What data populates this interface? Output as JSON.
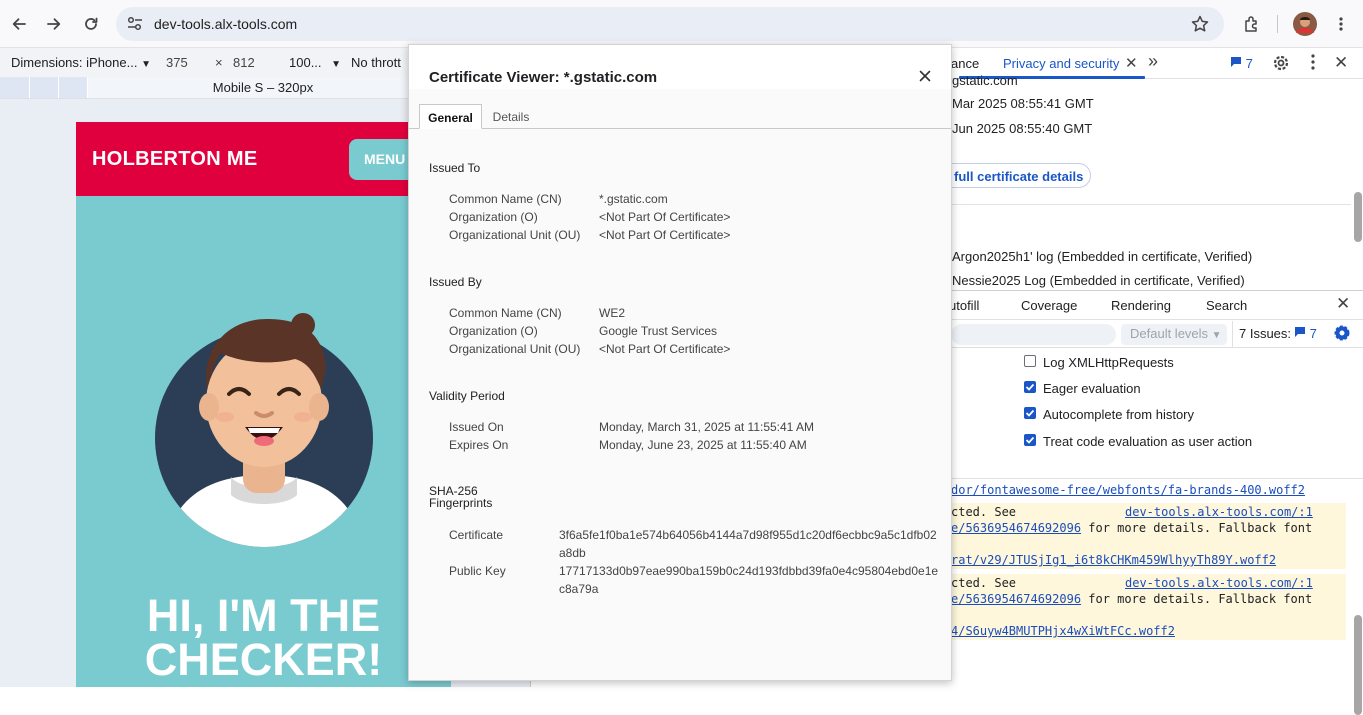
{
  "browser": {
    "url": "dev-tools.alx-tools.com"
  },
  "device_toolbar": {
    "dimensions_label": "Dimensions: iPhone...",
    "width": "375",
    "times": "×",
    "height": "812",
    "zoom": "100...",
    "throttle": "No thrott",
    "ruler_label": "Mobile S – 320px"
  },
  "site": {
    "brand": "HOLBERTON ME",
    "menu_label": "MENU",
    "hero_line1": "HI, I'M THE",
    "hero_line2": "CHECKER!",
    "colors": {
      "header": "#e1003e",
      "background": "#79cbd0"
    }
  },
  "devtools": {
    "tabs": [
      {
        "label": "ance"
      },
      {
        "label": "Privacy and security"
      }
    ],
    "more_tabs": "»",
    "issues_count": "7",
    "security_panel": {
      "line_subject": "gstatic.com",
      "line_valid_from": "Mar 2025 08:55:41 GMT",
      "line_valid_to": "Jun 2025 08:55:40 GMT",
      "cert_button": "full certificate details",
      "log1": "Argon2025h1' log (Embedded in certificate, Verified)",
      "log2": "Nessie2025 Log (Embedded in certificate, Verified)"
    },
    "drawer_tabs": [
      "utofill",
      "Coverage",
      "Rendering",
      "Search"
    ],
    "console_bar": {
      "levels": "Default levels",
      "issues_text": "7 Issues:",
      "issues_count": "7"
    },
    "settings": [
      {
        "label": "Log XMLHttpRequests",
        "checked": false
      },
      {
        "label": "Eager evaluation",
        "checked": true
      },
      {
        "label": "Autocomplete from history",
        "checked": true
      },
      {
        "label": "Treat code evaluation as user action",
        "checked": true
      }
    ],
    "console_lines": {
      "l1": "dor/fontawesome-free/webfonts/fa-brands-400.woff2",
      "w1a": "cted. See",
      "w1link": "dev-tools.alx-tools.com/:1",
      "w1b": "e/5636954674692096",
      "w1c": " for more details. Fallback font",
      "w1d": "rat/v29/JTUSjIg1_i6t8kCHKm459WlhyyTh89Y.woff2",
      "w2a": "cted. See",
      "w2link": "dev-tools.alx-tools.com/:1",
      "w2b": "e/5636954674692096",
      "w2c": " for more details. Fallback font",
      "w2d": "4/S6uyw4BMUTPHjx4wXiWtFCc.woff2"
    }
  },
  "certificate_viewer": {
    "title": "Certificate Viewer: *.gstatic.com",
    "tabs": {
      "general": "General",
      "details": "Details"
    },
    "issued_to": {
      "heading": "Issued To",
      "cn_label": "Common Name (CN)",
      "cn": "*.gstatic.com",
      "o_label": "Organization (O)",
      "o": "<Not Part Of Certificate>",
      "ou_label": "Organizational Unit (OU)",
      "ou": "<Not Part Of Certificate>"
    },
    "issued_by": {
      "heading": "Issued By",
      "cn_label": "Common Name (CN)",
      "cn": "WE2",
      "o_label": "Organization (O)",
      "o": "Google Trust Services",
      "ou_label": "Organizational Unit (OU)",
      "ou": "<Not Part Of Certificate>"
    },
    "validity": {
      "heading": "Validity Period",
      "issued_label": "Issued On",
      "issued": "Monday, March 31, 2025 at 11:55:41 AM",
      "expires_label": "Expires On",
      "expires": "Monday, June 23, 2025 at 11:55:40 AM"
    },
    "fingerprints": {
      "heading_line1": "SHA-256",
      "heading_line2": "Fingerprints",
      "cert_label": "Certificate",
      "cert": "3f6a5fe1f0ba1e574b64056b4144a7d98f955d1c20df6ecbbc9a5c1dfb02a8db",
      "pk_label": "Public Key",
      "pk": "17717133d0b97eae990ba159b0c24d193fdbbd39fa0e4c95804ebd0e1ec8a79a"
    }
  }
}
